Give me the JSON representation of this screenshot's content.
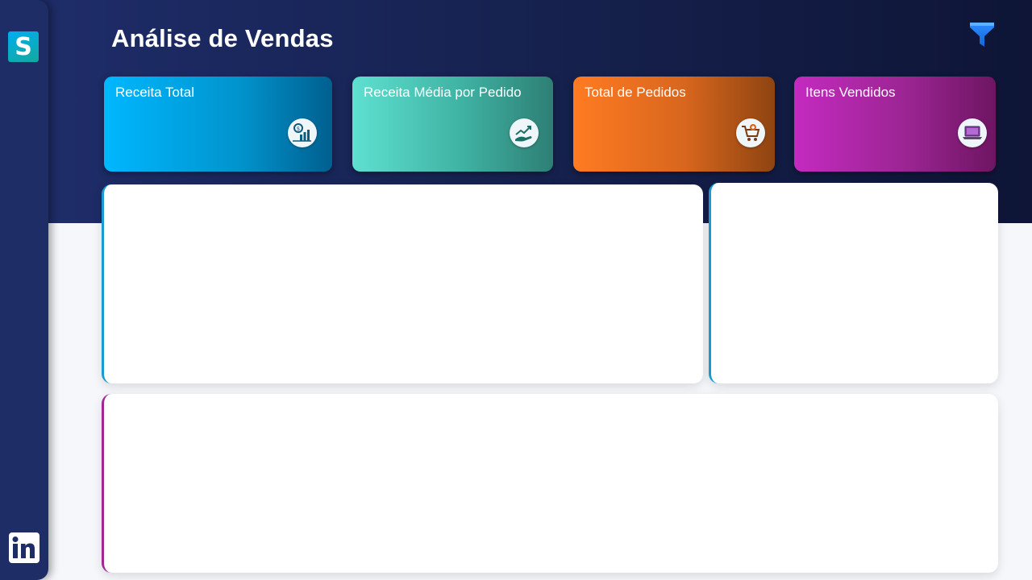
{
  "header": {
    "title_light": "Análise de",
    "title_bold": "Vendas",
    "filter_icon": "filter-icon"
  },
  "sidebar": {
    "logo_letter": "S",
    "bottom_icon": "linkedin-icon"
  },
  "kpis": [
    {
      "label": "Receita Total",
      "icon": "revenue-chart-icon",
      "color": "#00b7ff"
    },
    {
      "label": "Receita Média por Pedido",
      "icon": "hand-growth-icon",
      "color": "#3fb2a3"
    },
    {
      "label": "Total de Pedidos",
      "icon": "shopping-cart-icon",
      "color": "#ff7b22"
    },
    {
      "label": "Itens Vendidos",
      "icon": "laptop-icon",
      "color": "#c42ac0"
    }
  ],
  "colors": {
    "header_dark": "#0e1536",
    "sidebar": "#1f2d66",
    "panel_accent_blue": "#1a9ad0",
    "panel_accent_purple": "#a2288f"
  }
}
